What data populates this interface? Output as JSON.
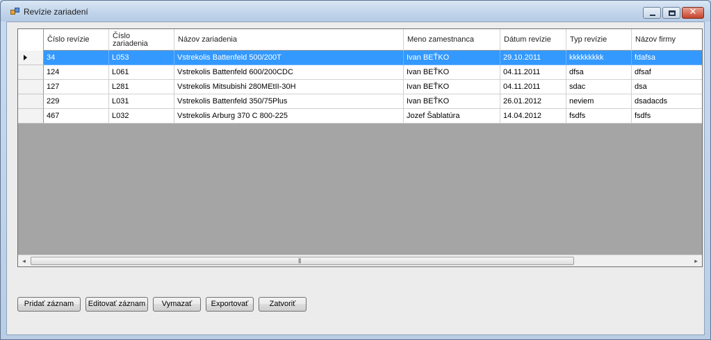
{
  "window": {
    "title": "Revízie zariadení",
    "controls": {
      "minimize": "minimize-icon",
      "maximize": "maximize-icon",
      "close": "✕"
    }
  },
  "grid": {
    "columns": [
      "Číslo revízie",
      "Číslo\nzariadenia",
      "Názov zariadenia",
      "Meno zamestnanca",
      "Dátum revízie",
      "Typ revízie",
      "Názov firmy"
    ],
    "rows": [
      [
        "34",
        "L053",
        "Vstrekolis Battenfeld 500/200T",
        "Ivan BEŤKO",
        "29.10.2011",
        "kkkkkkkkk",
        "fdafsa"
      ],
      [
        "124",
        "L061",
        "Vstrekolis Battenfeld 600/200CDC",
        "Ivan BEŤKO",
        "04.11.2011",
        "dfsa",
        "dfsaf"
      ],
      [
        "127",
        "L281",
        "Vstrekolis Mitsubishi 280MEtII-30H",
        "Ivan BEŤKO",
        "04.11.2011",
        "sdac",
        "dsa"
      ],
      [
        "229",
        "L031",
        "Vstrekolis Battenfeld 350/75Plus",
        "Ivan BEŤKO",
        "26.01.2012",
        "neviem",
        "dsadacds"
      ],
      [
        "467",
        "L032",
        "Vstrekolis Arburg 370 C 800-225",
        "Jozef Šablatúra",
        "14.04.2012",
        "fsdfs",
        "fsdfs"
      ]
    ],
    "selected_row": 0,
    "scroll": {
      "left_arrow": "◂",
      "right_arrow": "▸",
      "grip": "|||"
    }
  },
  "buttons": {
    "add": "Pridať záznam",
    "edit": "Editovať záznam",
    "delete": "Vymazať",
    "export": "Exportovať",
    "close": "Zatvoriť"
  },
  "colors": {
    "selection": "#3399ff",
    "grid_background": "#a5a5a5"
  }
}
